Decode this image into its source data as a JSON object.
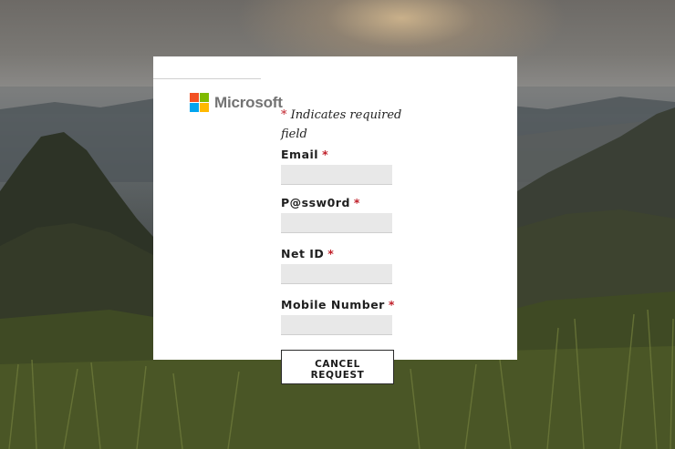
{
  "brand": {
    "name": "Microsoft",
    "logo_colors": [
      "#f25022",
      "#7fba00",
      "#00a4ef",
      "#ffb900"
    ]
  },
  "form": {
    "required_note_marker": "*",
    "required_note_text": " Indicates required field",
    "fields": [
      {
        "label": "Email",
        "required_marker": "*",
        "value": "",
        "placeholder": ""
      },
      {
        "label": "P@ssw0rd",
        "required_marker": "*",
        "value": "",
        "placeholder": ""
      },
      {
        "label": "Net ID",
        "required_marker": "*",
        "value": "",
        "placeholder": ""
      },
      {
        "label": "Mobile Number",
        "required_marker": "*",
        "value": "",
        "placeholder": ""
      }
    ],
    "cancel_label_line1": "CANCEL",
    "cancel_label_line2": "REQUEST"
  },
  "colors": {
    "required_asterisk": "#c0202a",
    "field_background": "#e8e8e8",
    "card_background": "#ffffff"
  }
}
